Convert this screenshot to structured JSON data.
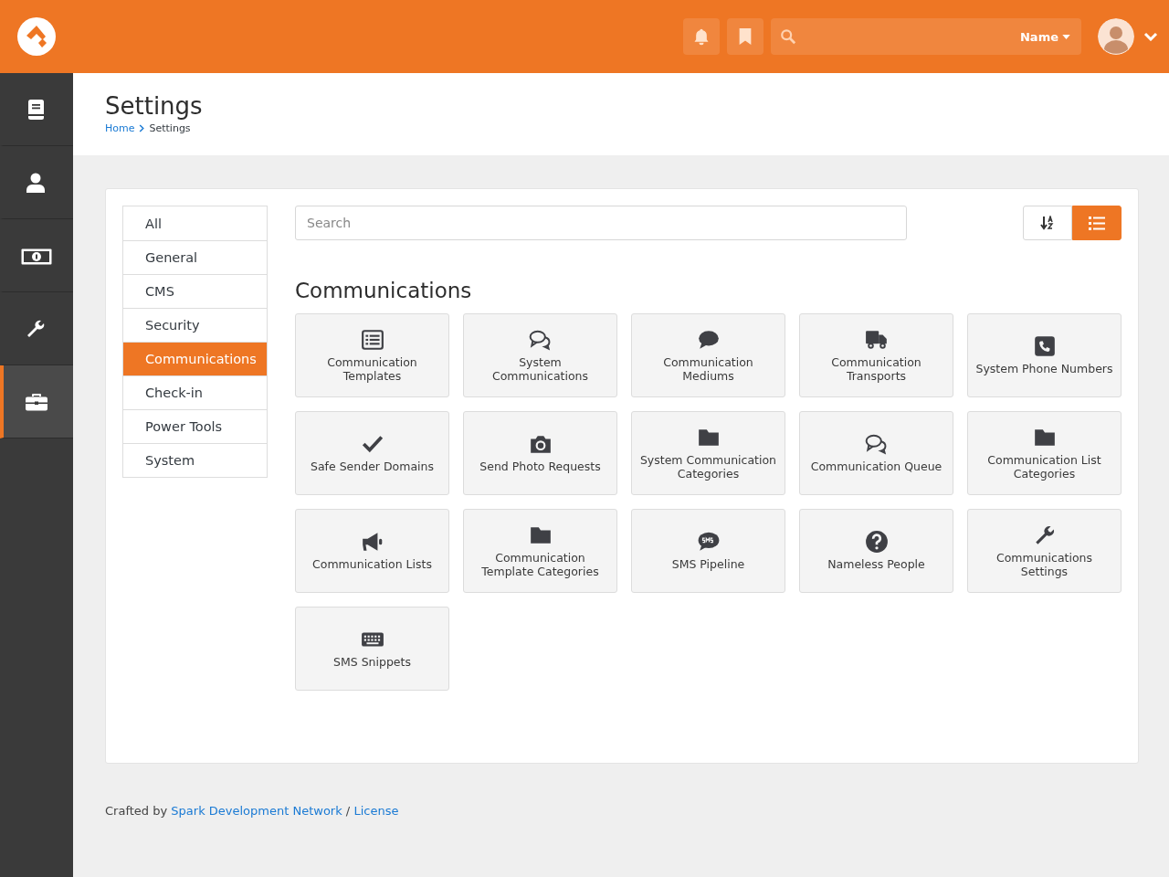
{
  "header": {
    "search_scope": "Name"
  },
  "nav": [
    {
      "selected": false
    },
    {
      "selected": false
    },
    {
      "selected": false
    },
    {
      "selected": false
    },
    {
      "selected": true
    }
  ],
  "page": {
    "title": "Settings",
    "breadcrumbs": [
      "Home",
      "Settings"
    ]
  },
  "filters": [
    {
      "label": "All",
      "selected": false
    },
    {
      "label": "General",
      "selected": false
    },
    {
      "label": "CMS",
      "selected": false
    },
    {
      "label": "Security",
      "selected": false
    },
    {
      "label": "Communications",
      "selected": true
    },
    {
      "label": "Check-in",
      "selected": false
    },
    {
      "label": "Power Tools",
      "selected": false
    },
    {
      "label": "System",
      "selected": false
    }
  ],
  "search": {
    "placeholder": "Search"
  },
  "view_buttons": [
    {
      "selected": false
    },
    {
      "selected": true
    }
  ],
  "section": {
    "title": "Communications"
  },
  "tiles": [
    {
      "label": "Communication Templates"
    },
    {
      "label": "System Communications"
    },
    {
      "label": "Communication Mediums"
    },
    {
      "label": "Communication Transports"
    },
    {
      "label": "System Phone Numbers"
    },
    {
      "label": "Safe Sender Domains"
    },
    {
      "label": "Send Photo Requests"
    },
    {
      "label": "System Communication Categories"
    },
    {
      "label": "Communication Queue"
    },
    {
      "label": "Communication List Categories"
    },
    {
      "label": "Communication Lists"
    },
    {
      "label": "Communication Template Categories"
    },
    {
      "label": "SMS Pipeline"
    },
    {
      "label": "Nameless People"
    },
    {
      "label": "Communications Settings"
    },
    {
      "label": "SMS Snippets"
    }
  ],
  "footer": {
    "prefix": "Crafted by",
    "link": "Spark Development Network",
    "separator": "/",
    "license": "License"
  }
}
